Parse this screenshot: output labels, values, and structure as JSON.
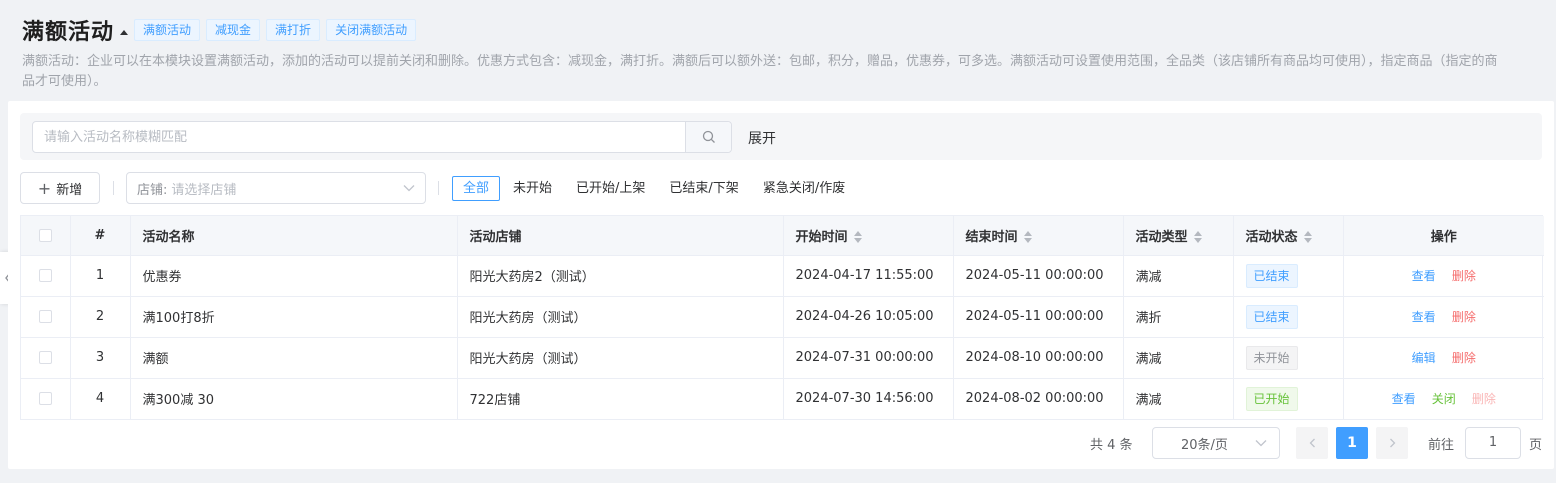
{
  "header": {
    "title": "满额活动",
    "tags": [
      "满额活动",
      "减现金",
      "满打折",
      "关闭满额活动"
    ],
    "description": "满额活动：企业可以在本模块设置满额活动，添加的活动可以提前关闭和删除。优惠方式包含：减现金，满打折。满额后可以额外送：包邮，积分，赠品，优惠券，可多选。满额活动可设置使用范围，全品类（该店铺所有商品均可使用），指定商品（指定的商品才可使用）。"
  },
  "search": {
    "placeholder": "请输入活动名称模糊匹配",
    "expand_label": "展开"
  },
  "toolbar": {
    "add_label": "新增",
    "store_label": "店铺:",
    "store_placeholder": "请选择店铺",
    "filters": [
      "全部",
      "未开始",
      "已开始/上架",
      "已结束/下架",
      "紧急关闭/作废"
    ],
    "active_filter": "全部"
  },
  "table": {
    "headers": {
      "index": "#",
      "name": "活动名称",
      "store": "活动店铺",
      "start": "开始时间",
      "end": "结束时间",
      "type": "活动类型",
      "status": "活动状态",
      "ops": "操作"
    },
    "rows": [
      {
        "index": "1",
        "name": "优惠券",
        "store": "阳光大药房2（测试）",
        "start": "2024-04-17 11:55:00",
        "end": "2024-05-11 00:00:00",
        "type": "满减",
        "status": "已结束",
        "ops": [
          "查看",
          "删除"
        ]
      },
      {
        "index": "2",
        "name": "满100打8折",
        "store": "阳光大药房（测试）",
        "start": "2024-04-26 10:05:00",
        "end": "2024-05-11 00:00:00",
        "type": "满折",
        "status": "已结束",
        "ops": [
          "查看",
          "删除"
        ]
      },
      {
        "index": "3",
        "name": "满额",
        "store": "阳光大药房（测试）",
        "start": "2024-07-31 00:00:00",
        "end": "2024-08-10 00:00:00",
        "type": "满减",
        "status": "未开始",
        "ops": [
          "编辑",
          "删除"
        ]
      },
      {
        "index": "4",
        "name": "满300减 30",
        "store": "722店铺",
        "start": "2024-07-30 14:56:00",
        "end": "2024-08-02 00:00:00",
        "type": "满减",
        "status": "已开始",
        "ops": [
          "查看",
          "关闭",
          "删除"
        ]
      }
    ]
  },
  "pagination": {
    "total_text": "共 4 条",
    "page_size": "20条/页",
    "current_page": "1",
    "goto_label": "前往",
    "goto_value": "1",
    "page_unit": "页"
  },
  "colors": {
    "primary": "#409eff",
    "danger": "#f56c6c",
    "success": "#67c23a",
    "info": "#909399"
  }
}
